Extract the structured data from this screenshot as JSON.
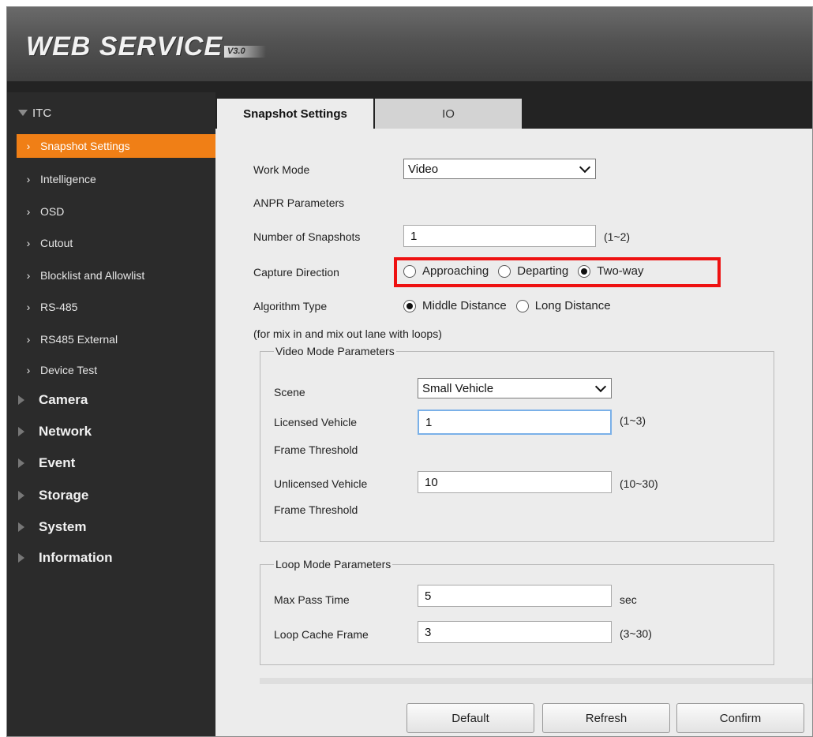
{
  "header": {
    "logo_text": "WEB  SERVICE",
    "logo_version": "V3.0"
  },
  "sidebar": {
    "root": {
      "label": "ITC"
    },
    "sub_items": [
      {
        "label": "Snapshot Settings",
        "active": true
      },
      {
        "label": "Intelligence"
      },
      {
        "label": "OSD"
      },
      {
        "label": "Cutout"
      },
      {
        "label": "Blocklist and Allowlist"
      },
      {
        "label": "RS-485"
      },
      {
        "label": "RS485 External"
      },
      {
        "label": "Device Test"
      }
    ],
    "groups": [
      {
        "label": "Camera"
      },
      {
        "label": "Network"
      },
      {
        "label": "Event"
      },
      {
        "label": "Storage"
      },
      {
        "label": "System"
      },
      {
        "label": "Information"
      }
    ]
  },
  "tabs": [
    {
      "label": "Snapshot Settings",
      "active": true
    },
    {
      "label": "IO",
      "active": false
    }
  ],
  "form": {
    "work_mode": {
      "label": "Work Mode",
      "value": "Video"
    },
    "anpr_heading": "ANPR Parameters",
    "num_snapshots": {
      "label": "Number of Snapshots",
      "value": "1",
      "range": "(1~2)"
    },
    "capture_direction": {
      "label": "Capture Direction",
      "options": [
        "Approaching",
        "Departing",
        "Two-way"
      ],
      "selected": "Two-way"
    },
    "algorithm_type": {
      "label": "Algorithm Type",
      "options": [
        "Middle Distance",
        "Long Distance"
      ],
      "selected": "Middle Distance"
    },
    "note": "(for mix in and mix out lane with loops)",
    "video_mode": {
      "legend": "Video Mode Parameters",
      "scene": {
        "label": "Scene",
        "value": "Small Vehicle"
      },
      "licensed": {
        "label_line1": "Licensed Vehicle",
        "label_line2": "Frame Threshold",
        "value": "1",
        "range": "(1~3)"
      },
      "unlicensed": {
        "label_line1": "Unlicensed Vehicle",
        "label_line2": "Frame Threshold",
        "value": "10",
        "range": "(10~30)"
      }
    },
    "loop_mode": {
      "legend": "Loop Mode Parameters",
      "max_pass_time": {
        "label": "Max Pass Time",
        "value": "5",
        "unit": "sec"
      },
      "loop_cache_frame": {
        "label": "Loop Cache Frame",
        "value": "3",
        "range": "(3~30)"
      }
    }
  },
  "buttons": {
    "default": "Default",
    "refresh": "Refresh",
    "confirm": "Confirm"
  },
  "colors": {
    "active_nav": "#f07f16",
    "highlight_box": "#ee1111",
    "sidebar_bg": "#2b2b2b"
  }
}
